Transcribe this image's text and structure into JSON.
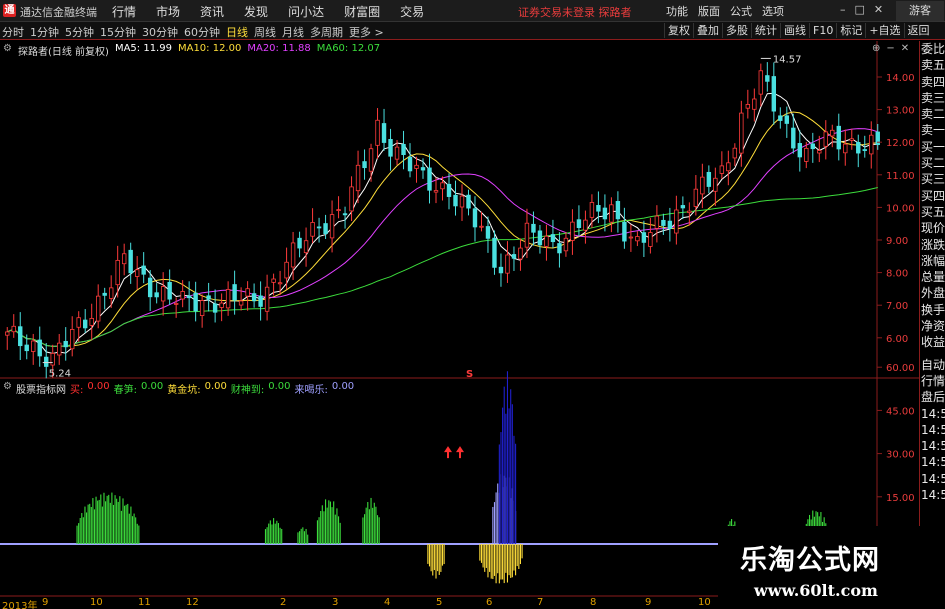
{
  "window": {
    "app_title": "通达信金融终端",
    "menu": [
      "行情",
      "市场",
      "资讯",
      "发现",
      "问小达",
      "财富圈",
      "交易"
    ],
    "notice": "证券交易未登录  探路者",
    "right_menu": [
      "功能",
      "版面",
      "公式",
      "选项"
    ],
    "guest_label": "游客"
  },
  "toolbar": {
    "periods": [
      "分时",
      "1分钟",
      "5分钟",
      "15分钟",
      "30分钟",
      "60分钟",
      "日线",
      "周线",
      "月线",
      "多周期",
      "更多 >"
    ],
    "active_period": "日线",
    "buttons": [
      "复权",
      "叠加",
      "多股",
      "统计",
      "画线",
      "F10",
      "标记",
      "+自选",
      "返回"
    ]
  },
  "main_legend": {
    "title": "探路者(日线 前复权)",
    "ma": [
      {
        "label": "MA5: 11.99",
        "color": "#ffffff"
      },
      {
        "label": "MA10: 12.00",
        "color": "#ffde3a"
      },
      {
        "label": "MA20: 11.88",
        "color": "#e040ff"
      },
      {
        "label": "MA60: 12.07",
        "color": "#3cdc3c"
      }
    ]
  },
  "indicator_legend": {
    "title": "股票指标网",
    "items": [
      {
        "label": "买:",
        "value": "0.00",
        "color": "#ff3030"
      },
      {
        "label": "春笋:",
        "value": "0.00",
        "color": "#3cdc3c"
      },
      {
        "label": "黄金坑:",
        "value": "0.00",
        "color": "#ffde3a"
      },
      {
        "label": "财神到:",
        "value": "0.00",
        "color": "#3cdc3c"
      },
      {
        "label": "来喝乐:",
        "value": "0.00",
        "color": "#9fa0ff"
      }
    ]
  },
  "price_axis": [
    "14.00",
    "13.00",
    "12.00",
    "11.00",
    "10.00",
    "9.00",
    "8.00",
    "7.00",
    "6.00"
  ],
  "indicator_axis": [
    "60.00",
    "45.00",
    "30.00",
    "15.00"
  ],
  "annotations": {
    "high": "14.57",
    "low": "5.24",
    "marker": "S"
  },
  "right_panel": [
    "委比",
    "卖五",
    "卖四",
    "卖三",
    "卖二",
    "卖一",
    "买一",
    "买二",
    "买三",
    "买四",
    "买五",
    "现价",
    "涨跌",
    "涨幅",
    "总量",
    "外盘",
    "换手",
    "净资",
    "收益"
  ],
  "right_panel_lower": [
    "自动",
    "行情",
    "盘后",
    "14:50",
    "14:50",
    "14:50",
    "14:50",
    "14:50",
    "14:50"
  ],
  "date_axis": [
    "2013年",
    "9",
    "10",
    "11",
    "12",
    "2",
    "3",
    "4",
    "5",
    "6",
    "7",
    "8",
    "9",
    "10"
  ],
  "watermark": {
    "name": "乐淘公式网",
    "url": "www.60lt.com"
  },
  "chart_data": {
    "type": "candlestick",
    "ylim": [
      5.0,
      15.0
    ],
    "indicator_ylim": [
      -15,
      65
    ],
    "ma_series": [
      {
        "name": "MA5",
        "color": "#ffffff"
      },
      {
        "name": "MA10",
        "color": "#ffde3a"
      },
      {
        "name": "MA20",
        "color": "#e040ff"
      },
      {
        "name": "MA60",
        "color": "#3cdc3c"
      }
    ],
    "indicator_blocks": [
      {
        "series": "春笋",
        "color": "#3cdc3c",
        "range": [
          11,
          20
        ],
        "peak": 18
      },
      {
        "series": "春笋",
        "color": "#3cdc3c",
        "range": [
          40,
          42
        ],
        "peak": 9
      },
      {
        "series": "春笋",
        "color": "#3cdc3c",
        "range": [
          45,
          46
        ],
        "peak": 6
      },
      {
        "series": "春笋",
        "color": "#3cdc3c",
        "range": [
          48,
          51
        ],
        "peak": 16
      },
      {
        "series": "春笋",
        "color": "#3cdc3c",
        "range": [
          55,
          57
        ],
        "peak": 16
      },
      {
        "series": "黄金坑",
        "color": "#ffde3a",
        "range": [
          65,
          67
        ],
        "peak": -12
      },
      {
        "series": "黄金坑",
        "color": "#ffde3a",
        "range": [
          73,
          79
        ],
        "peak": -14
      },
      {
        "series": "来喝乐",
        "color": "#9fa0ff",
        "range": [
          75,
          78
        ],
        "peak": 25
      },
      {
        "series": "买",
        "color": "#2020cc",
        "range": [
          76,
          78
        ],
        "peak": 60
      },
      {
        "series": "春笋",
        "color": "#3cdc3c",
        "range": [
          111,
          112
        ],
        "peak": 9
      },
      {
        "series": "春笋",
        "color": "#3cdc3c",
        "range": [
          123,
          126
        ],
        "peak": 12
      }
    ]
  }
}
